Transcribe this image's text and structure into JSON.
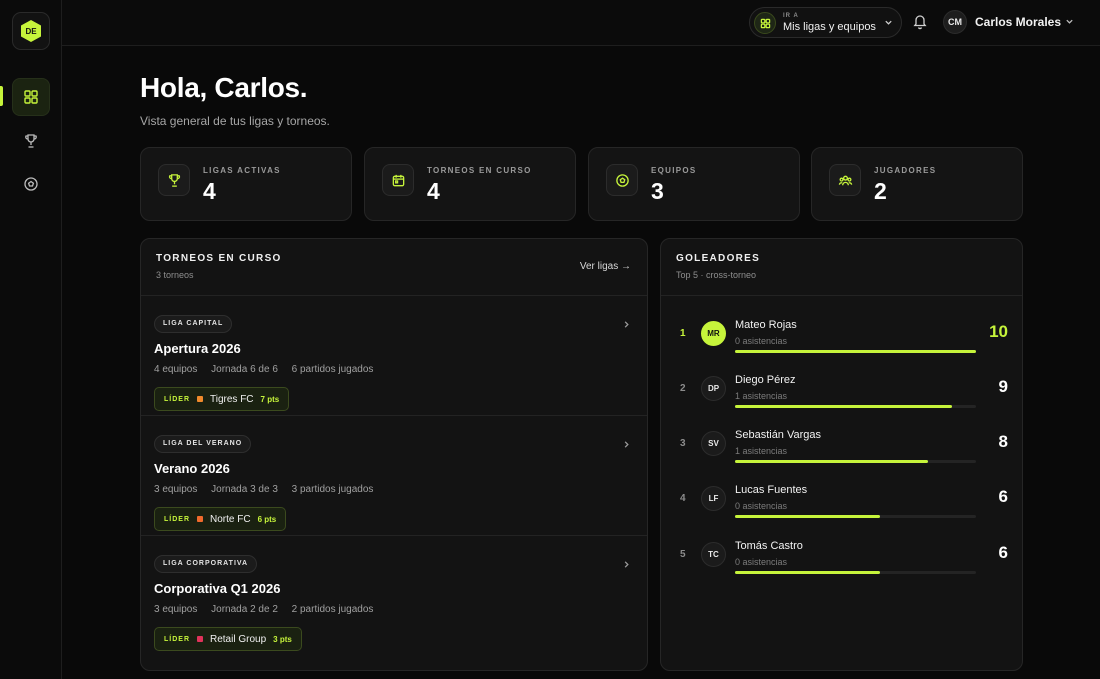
{
  "logo": "DE",
  "sidebar": {
    "items": [
      {
        "icon": "dashboard-icon",
        "active": true
      },
      {
        "icon": "trophy-icon",
        "active": false
      },
      {
        "icon": "soccer-ball-icon",
        "active": false
      }
    ]
  },
  "header": {
    "goto_kicker": "IR A",
    "goto_value": "Mis ligas y equipos",
    "user_initials": "CM",
    "user_name": "Carlos Morales"
  },
  "page": {
    "greeting": "Hola, Carlos.",
    "subtitle": "Vista general de tus ligas y torneos."
  },
  "stats": [
    {
      "label": "LIGAS ACTIVAS",
      "value": "4",
      "icon": "trophy-icon"
    },
    {
      "label": "TORNEOS EN CURSO",
      "value": "4",
      "icon": "calendar-icon"
    },
    {
      "label": "EQUIPOS",
      "value": "3",
      "icon": "soccer-ball-icon"
    },
    {
      "label": "JUGADORES",
      "value": "2",
      "icon": "players-icon"
    }
  ],
  "tournaments_panel": {
    "title": "TORNEOS EN CURSO",
    "subtitle": "3 torneos",
    "link": "Ver ligas →",
    "items": [
      {
        "league": "LIGA CAPITAL",
        "name": "Apertura 2026",
        "teams": "4 equipos",
        "round": "Jornada 6 de 6",
        "played": "6 partidos jugados",
        "leader_label": "LÍDER",
        "leader_team": "Tigres FC",
        "leader_pts": "7 pts",
        "leader_color": "#f08a2c"
      },
      {
        "league": "LIGA DEL VERANO",
        "name": "Verano 2026",
        "teams": "3 equipos",
        "round": "Jornada 3 de 3",
        "played": "3 partidos jugados",
        "leader_label": "LÍDER",
        "leader_team": "Norte FC",
        "leader_pts": "6 pts",
        "leader_color": "#f06a2c"
      },
      {
        "league": "LIGA CORPORATIVA",
        "name": "Corporativa Q1 2026",
        "teams": "3 equipos",
        "round": "Jornada 2 de 2",
        "played": "2 partidos jugados",
        "leader_label": "LÍDER",
        "leader_team": "Retail Group",
        "leader_pts": "3 pts",
        "leader_color": "#e0335a"
      }
    ]
  },
  "scorers_panel": {
    "title": "GOLEADORES",
    "subtitle": "Top 5 · cross-torneo",
    "items": [
      {
        "rank": "1",
        "initials": "MR",
        "name": "Mateo Rojas",
        "assists": "0 asistencias",
        "goals": "10",
        "bar_fraction": 1.0
      },
      {
        "rank": "2",
        "initials": "DP",
        "name": "Diego Pérez",
        "assists": "1 asistencias",
        "goals": "9",
        "bar_fraction": 0.9
      },
      {
        "rank": "3",
        "initials": "SV",
        "name": "Sebastián Vargas",
        "assists": "1 asistencias",
        "goals": "8",
        "bar_fraction": 0.8
      },
      {
        "rank": "4",
        "initials": "LF",
        "name": "Lucas Fuentes",
        "assists": "0 asistencias",
        "goals": "6",
        "bar_fraction": 0.6
      },
      {
        "rank": "5",
        "initials": "TC",
        "name": "Tomás Castro",
        "assists": "0 asistencias",
        "goals": "6",
        "bar_fraction": 0.6
      }
    ]
  },
  "colors": {
    "accent": "#c6f43b",
    "background": "#090909",
    "card": "#141414"
  }
}
